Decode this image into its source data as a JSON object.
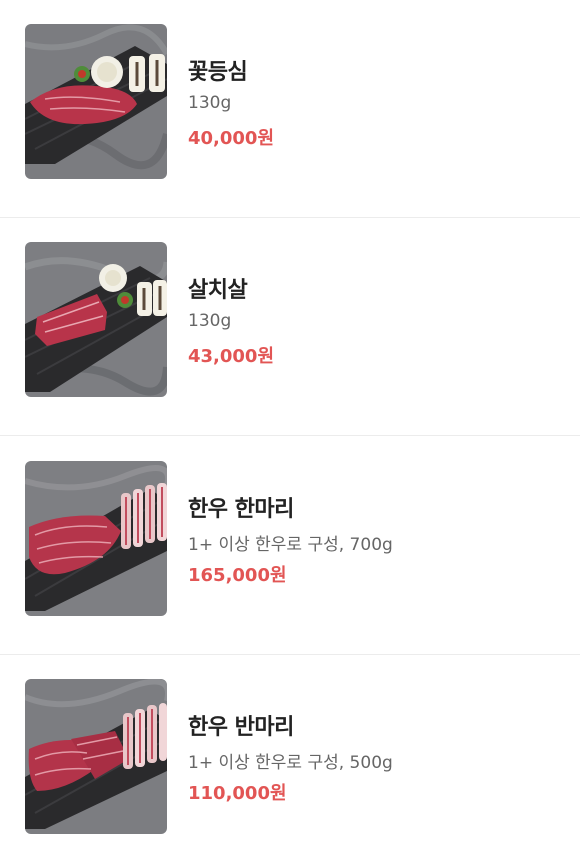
{
  "items": [
    {
      "name": "꽃등심",
      "desc": "130g",
      "price": "40,000원",
      "image_icon": "ribeye-photo-icon"
    },
    {
      "name": "살치살",
      "desc": "130g",
      "price": "43,000원",
      "image_icon": "chuck-flap-photo-icon"
    },
    {
      "name": "한우 한마리",
      "desc": "1+ 이상 한우로 구성, 700g",
      "price": "165,000원",
      "image_icon": "beef-platter-photo-icon"
    },
    {
      "name": "한우 반마리",
      "desc": "1+ 이상 한우로 구성, 500g",
      "price": "110,000원",
      "image_icon": "beef-platter-photo-icon"
    }
  ],
  "colors": {
    "price": "#e25554",
    "name": "#222222",
    "desc": "#666666",
    "divider": "#ececec"
  }
}
